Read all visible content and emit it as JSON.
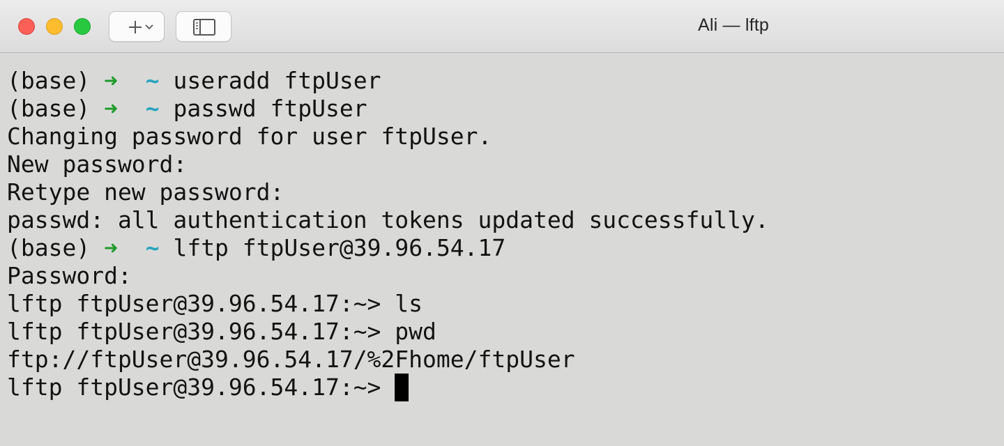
{
  "window": {
    "title": "Ali — lftp"
  },
  "toolbar": {
    "new_tab_icon": "plus-chevron-icon",
    "sidebar_icon": "sidebar-icon"
  },
  "colors": {
    "prompt_arrow": "#1f9a2a",
    "prompt_tilde": "#2aa3bf",
    "text": "#121212",
    "background": "#d9dad8"
  },
  "terminal": {
    "prompt": {
      "env": "(base) ",
      "arrow": "➜",
      "tilde": "~",
      "gap1": "  ",
      "gap2": " "
    },
    "lines": [
      {
        "type": "prompt",
        "command": "useradd ftpUser"
      },
      {
        "type": "prompt",
        "command": "passwd ftpUser"
      },
      {
        "type": "output",
        "text": "Changing password for user ftpUser."
      },
      {
        "type": "output",
        "text": "New password:"
      },
      {
        "type": "output",
        "text": "Retype new password:"
      },
      {
        "type": "output",
        "text": "passwd: all authentication tokens updated successfully."
      },
      {
        "type": "prompt",
        "command": "lftp ftpUser@39.96.54.17"
      },
      {
        "type": "output",
        "text": "Password:"
      },
      {
        "type": "output",
        "text": "lftp ftpUser@39.96.54.17:~> ls"
      },
      {
        "type": "output",
        "text": "lftp ftpUser@39.96.54.17:~> pwd"
      },
      {
        "type": "output",
        "text": "ftp://ftpUser@39.96.54.17/%2Fhome/ftpUser"
      },
      {
        "type": "output",
        "text": "lftp ftpUser@39.96.54.17:~> "
      }
    ]
  }
}
